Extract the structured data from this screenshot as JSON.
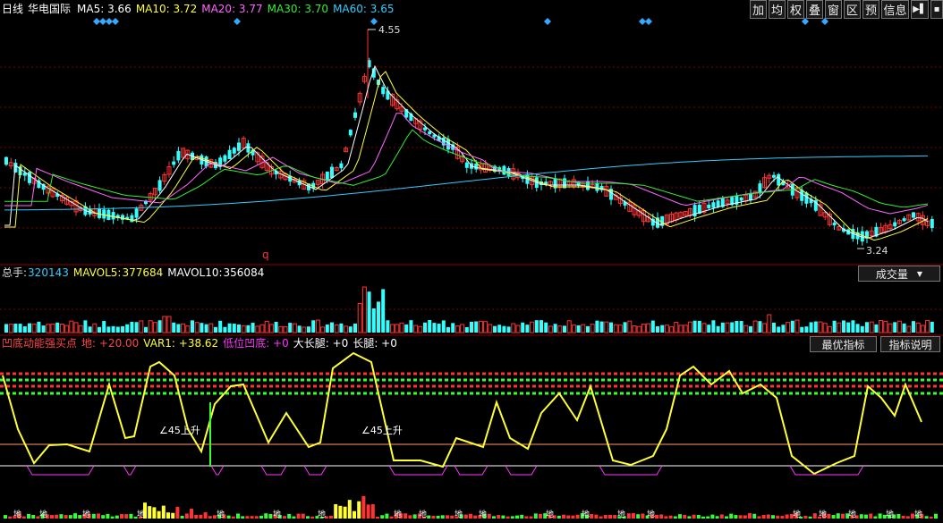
{
  "header": {
    "period": "日线",
    "stock_name": "华电国际",
    "indicators": [
      {
        "label": "MA5:",
        "value": "3.66",
        "color": "#ffffff"
      },
      {
        "label": "MA10:",
        "value": "3.72",
        "color": "#ffff33"
      },
      {
        "label": "MA20:",
        "value": "3.77",
        "color": "#ff66ff"
      },
      {
        "label": "MA30:",
        "value": "3.70",
        "color": "#33ee33"
      },
      {
        "label": "MA60:",
        "value": "3.65",
        "color": "#33ccff"
      }
    ]
  },
  "toolbar": {
    "buttons": [
      "加",
      "均",
      "权",
      "叠",
      "窗",
      "区",
      "预",
      "信息"
    ]
  },
  "price_chart": {
    "high_label": "4.55",
    "low_label": "3.24",
    "marker_q": "q"
  },
  "volume": {
    "label": "总手:",
    "value": "320143",
    "mavol5_label": "MAVOL5:",
    "mavol5": "377684",
    "mavol10_label": "MAVOL10:",
    "mavol10": "356084",
    "dropdown": "成交量"
  },
  "indicator_panel": {
    "name": "凹底动能强买点",
    "items": [
      {
        "label": "地:",
        "value": "+20.00",
        "color": "#ff4444"
      },
      {
        "label": "VAR1:",
        "value": "+38.62",
        "color": "#ffff33"
      },
      {
        "label": "低位凹底:",
        "value": "+0",
        "color": "#ff33ff"
      },
      {
        "label": "大长腿:",
        "value": "+0",
        "color": "#ffffff"
      },
      {
        "label": "长腿:",
        "value": "+0",
        "color": "#ffffff"
      }
    ],
    "btn_best": "最优指标",
    "btn_explain": "指标说明",
    "annotations": [
      "∠45上升",
      "∠45上升"
    ],
    "bottom_marker": "地"
  },
  "colors": {
    "up": "#ff3333",
    "down": "#33ffff",
    "grid": "#8b0000"
  }
}
